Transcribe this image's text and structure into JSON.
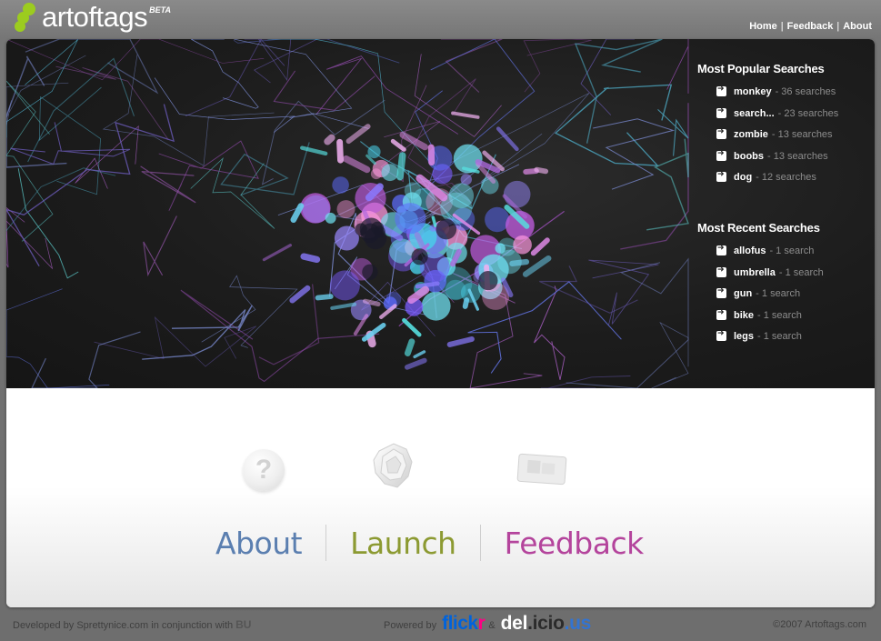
{
  "header": {
    "logo_text": "artoftags",
    "beta_label": "BETA",
    "nav": [
      "Home",
      "Feedback",
      "About"
    ],
    "nav_separator": "|"
  },
  "popular": {
    "heading": "Most Popular Searches",
    "items": [
      {
        "term": "monkey",
        "count": "- 36 searches"
      },
      {
        "term": "search...",
        "count": "- 23 searches"
      },
      {
        "term": "zombie",
        "count": "- 13 searches"
      },
      {
        "term": "boobs",
        "count": "- 13 searches"
      },
      {
        "term": "dog",
        "count": "- 12 searches"
      }
    ]
  },
  "recent": {
    "heading": "Most Recent Searches",
    "items": [
      {
        "term": "allofus",
        "count": "- 1 search"
      },
      {
        "term": "umbrella",
        "count": "- 1 search"
      },
      {
        "term": "gun",
        "count": "- 1 search"
      },
      {
        "term": "bike",
        "count": "- 1 search"
      },
      {
        "term": "legs",
        "count": "- 1 search"
      }
    ]
  },
  "main_links": {
    "about": "About",
    "launch": "Launch",
    "feedback": "Feedback",
    "help_icon_glyph": "?"
  },
  "footer": {
    "developed_by": "Developed by Sprettynice.com in conjunction with",
    "bu": "BU",
    "powered_by": "Powered by",
    "flickr_a": "flick",
    "flickr_b": "r",
    "ampersand": "&",
    "del_a": "del",
    "del_b": ".icio",
    "del_c": ".us",
    "copyright": "©2007 Artoftags.com"
  },
  "colors": {
    "logo_green": "#9ccc1f",
    "about_blue": "#5b7fb0",
    "launch_olive": "#8c9a32",
    "feedback_magenta": "#b4449c",
    "flickr_blue": "#0063dc",
    "flickr_pink": "#ff0084",
    "delicious_blue": "#3274d2"
  }
}
